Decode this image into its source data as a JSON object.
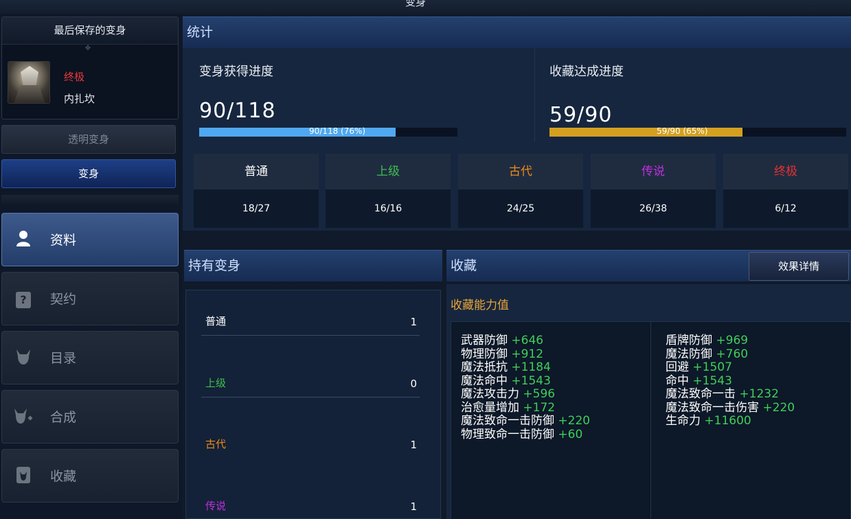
{
  "window": {
    "title": "变身"
  },
  "left": {
    "saved": {
      "title": "最后保存的变身",
      "grade": "终极",
      "name": "内扎坎"
    },
    "transparent_button": "透明变身",
    "morph_button": "变身",
    "nav": [
      {
        "label": "资料",
        "icon": "user-icon",
        "active": true
      },
      {
        "label": "契约",
        "icon": "contract-icon",
        "active": false
      },
      {
        "label": "目录",
        "icon": "demon-catalog-icon",
        "active": false
      },
      {
        "label": "合成",
        "icon": "demon-combine-icon",
        "active": false
      },
      {
        "label": "收藏",
        "icon": "collection-icon",
        "active": false
      }
    ]
  },
  "stats": {
    "header": "统计",
    "morph_progress": {
      "title": "变身获得进度",
      "value": "90/118",
      "bar_text": "90/118 (76%)",
      "fraction": 0.76,
      "color": "#4fa8f0"
    },
    "collection_progress": {
      "title": "收藏达成进度",
      "value": "59/90",
      "bar_text": "59/90 (65%)",
      "fraction": 0.65,
      "color": "#d4a020"
    },
    "grades": [
      {
        "name": "普通",
        "value": "18/27",
        "color": "#ffffff"
      },
      {
        "name": "上级",
        "value": "16/16",
        "color": "#3fbf4f"
      },
      {
        "name": "古代",
        "value": "24/25",
        "color": "#f08a1a"
      },
      {
        "name": "传说",
        "value": "26/38",
        "color": "#c030e0"
      },
      {
        "name": "终极",
        "value": "6/12",
        "color": "#e83030"
      }
    ]
  },
  "owned": {
    "header": "持有变身",
    "rows": [
      {
        "name": "普通",
        "count": "1",
        "color": "#ffffff"
      },
      {
        "name": "上级",
        "count": "0",
        "color": "#3fbf4f"
      },
      {
        "name": "古代",
        "count": "1",
        "color": "#f08a1a"
      },
      {
        "name": "传说",
        "count": "1",
        "color": "#c030e0"
      }
    ]
  },
  "collection": {
    "header": "收藏",
    "detail_button": "效果详情",
    "subtitle": "收藏能力值",
    "left_stats": [
      {
        "name": "武器防御",
        "value": "+646"
      },
      {
        "name": "物理防御",
        "value": "+912"
      },
      {
        "name": "魔法抵抗",
        "value": "+1184"
      },
      {
        "name": "魔法命中",
        "value": "+1543"
      },
      {
        "name": "魔法攻击力",
        "value": "+596"
      },
      {
        "name": "治愈量增加",
        "value": "+172"
      },
      {
        "name": "魔法致命一击防御",
        "value": "+220"
      },
      {
        "name": "物理致命一击防御",
        "value": "+60"
      }
    ],
    "right_stats": [
      {
        "name": "盾牌防御",
        "value": "+969"
      },
      {
        "name": "魔法防御",
        "value": "+760"
      },
      {
        "name": "回避",
        "value": "+1507"
      },
      {
        "name": "命中",
        "value": "+1543"
      },
      {
        "name": "魔法致命一击",
        "value": "+1232"
      },
      {
        "name": "魔法致命一击伤害",
        "value": "+220"
      },
      {
        "name": "生命力",
        "value": "+11600"
      }
    ]
  }
}
